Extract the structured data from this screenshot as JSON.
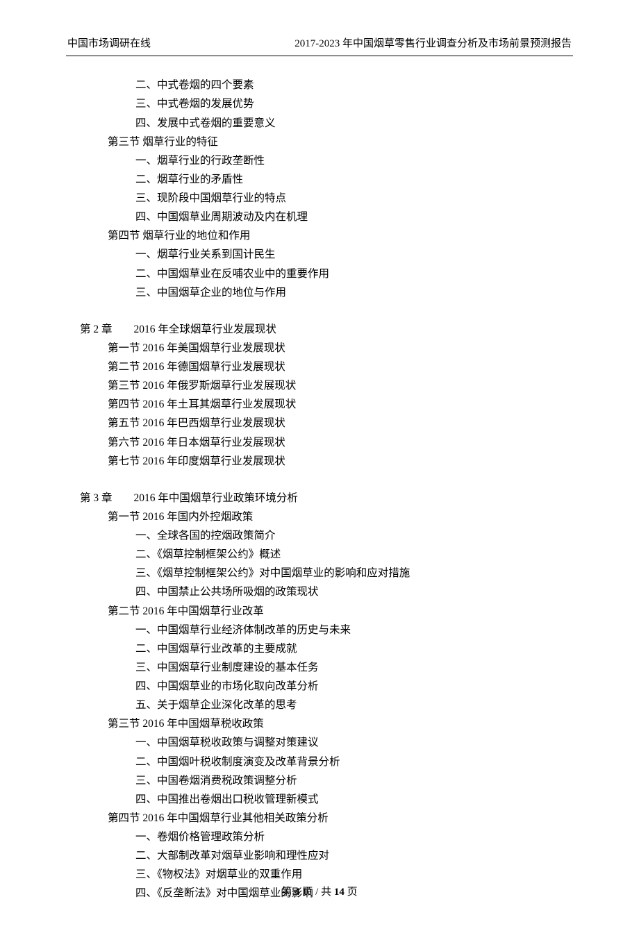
{
  "header": {
    "left": "中国市场调研在线",
    "right": "2017-2023 年中国烟草零售行业调查分析及市场前景预测报告"
  },
  "toc": [
    {
      "level": 2,
      "text": "二、中式卷烟的四个要素"
    },
    {
      "level": 2,
      "text": "三、中式卷烟的发展优势"
    },
    {
      "level": 2,
      "text": "四、发展中式卷烟的重要意义"
    },
    {
      "level": 1,
      "text": "第三节  烟草行业的特征"
    },
    {
      "level": 2,
      "text": "一、烟草行业的行政垄断性"
    },
    {
      "level": 2,
      "text": "二、烟草行业的矛盾性"
    },
    {
      "level": 2,
      "text": "三、现阶段中国烟草行业的特点"
    },
    {
      "level": 2,
      "text": "四、中国烟草业周期波动及内在机理"
    },
    {
      "level": 1,
      "text": "第四节  烟草行业的地位和作用"
    },
    {
      "level": 2,
      "text": "一、烟草行业关系到国计民生"
    },
    {
      "level": 2,
      "text": "二、中国烟草业在反哺农业中的重要作用"
    },
    {
      "level": 2,
      "text": "三、中国烟草企业的地位与作用"
    },
    {
      "level": -1,
      "text": "gap"
    },
    {
      "level": 0,
      "text": "第 2 章　　2016 年全球烟草行业发展现状"
    },
    {
      "level": 1,
      "text": "第一节  2016 年美国烟草行业发展现状"
    },
    {
      "level": 1,
      "text": "第二节  2016 年德国烟草行业发展现状"
    },
    {
      "level": 1,
      "text": "第三节  2016 年俄罗斯烟草行业发展现状"
    },
    {
      "level": 1,
      "text": "第四节  2016 年土耳其烟草行业发展现状"
    },
    {
      "level": 1,
      "text": "第五节  2016 年巴西烟草行业发展现状"
    },
    {
      "level": 1,
      "text": "第六节  2016 年日本烟草行业发展现状"
    },
    {
      "level": 1,
      "text": "第七节  2016 年印度烟草行业发展现状"
    },
    {
      "level": -1,
      "text": "gap"
    },
    {
      "level": 0,
      "text": "第 3 章　　2016 年中国烟草行业政策环境分析"
    },
    {
      "level": 1,
      "text": "第一节  2016 年国内外控烟政策"
    },
    {
      "level": 2,
      "text": "一、全球各国的控烟政策简介"
    },
    {
      "level": 2,
      "text": "二、《烟草控制框架公约》概述"
    },
    {
      "level": 2,
      "text": "三、《烟草控制框架公约》对中国烟草业的影响和应对措施"
    },
    {
      "level": 2,
      "text": "四、中国禁止公共场所吸烟的政策现状"
    },
    {
      "level": 1,
      "text": "第二节  2016 年中国烟草行业改革"
    },
    {
      "level": 2,
      "text": "一、中国烟草行业经济体制改革的历史与未来"
    },
    {
      "level": 2,
      "text": "二、中国烟草行业改革的主要成就"
    },
    {
      "level": 2,
      "text": "三、中国烟草行业制度建设的基本任务"
    },
    {
      "level": 2,
      "text": "四、中国烟草业的市场化取向改革分析"
    },
    {
      "level": 2,
      "text": "五、关于烟草企业深化改革的思考"
    },
    {
      "level": 1,
      "text": "第三节  2016 年中国烟草税收政策"
    },
    {
      "level": 2,
      "text": "一、中国烟草税收政策与调整对策建议"
    },
    {
      "level": 2,
      "text": "二、中国烟叶税收制度演变及改革背景分析"
    },
    {
      "level": 2,
      "text": "三、中国卷烟消费税政策调整分析"
    },
    {
      "level": 2,
      "text": "四、中国推出卷烟出口税收管理新模式"
    },
    {
      "level": 1,
      "text": "第四节  2016 年中国烟草行业其他相关政策分析"
    },
    {
      "level": 2,
      "text": "一、卷烟价格管理政策分析"
    },
    {
      "level": 2,
      "text": "二、大部制改革对烟草业影响和理性应对"
    },
    {
      "level": 2,
      "text": "三、《物权法》对烟草业的双重作用"
    },
    {
      "level": 2,
      "text": "四、《反垄断法》对中国烟草业的影响"
    }
  ],
  "footer": {
    "prefix": "第 ",
    "current": "4",
    "mid": " 页 / 共 ",
    "total": "14",
    "suffix": " 页"
  }
}
